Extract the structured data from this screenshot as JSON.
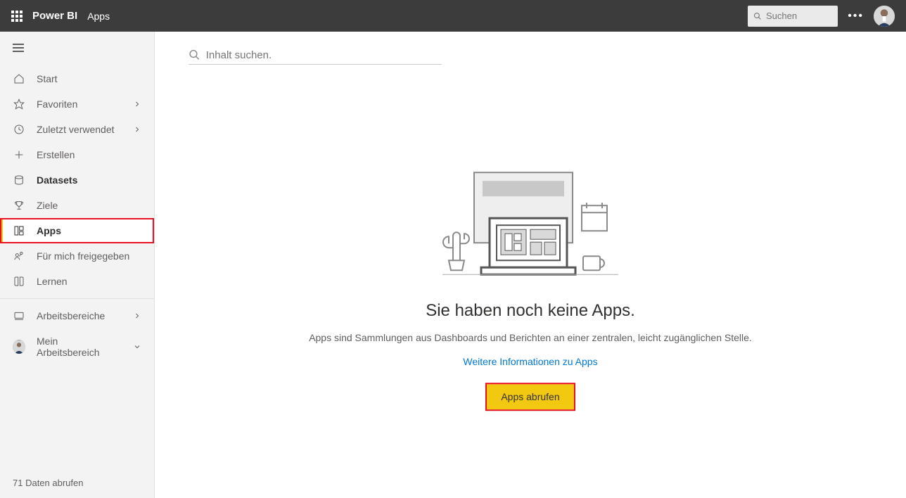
{
  "header": {
    "brand": "Power BI",
    "context": "Apps",
    "search_placeholder": "Suchen"
  },
  "sidebar": {
    "items": [
      {
        "label": "Start"
      },
      {
        "label": "Favoriten"
      },
      {
        "label": "Zuletzt verwendet"
      },
      {
        "label": "Erstellen"
      },
      {
        "label": "Datasets"
      },
      {
        "label": "Ziele"
      },
      {
        "label": "Apps"
      },
      {
        "label": "Für mich freigegeben"
      },
      {
        "label": "Lernen"
      },
      {
        "label": "Arbeitsbereiche"
      },
      {
        "label": "Mein Arbeitsbereich"
      }
    ],
    "footer": "71 Daten abrufen"
  },
  "main": {
    "search_placeholder": "Inhalt suchen.",
    "empty_title": "Sie haben noch keine Apps.",
    "empty_desc": "Apps sind Sammlungen aus Dashboards und Berichten an einer zentralen, leicht zugänglichen Stelle.",
    "empty_link": "Weitere Informationen zu Apps",
    "empty_button": "Apps abrufen"
  }
}
